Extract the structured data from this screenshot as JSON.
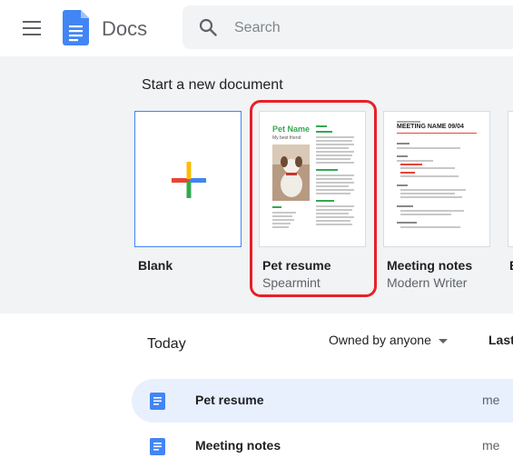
{
  "header": {
    "app_title": "Docs",
    "menu_icon": "hamburger-menu-icon",
    "logo_icon": "docs-logo-icon",
    "search": {
      "placeholder": "Search",
      "icon": "search-icon"
    }
  },
  "gallery": {
    "title": "Start a new document",
    "templates": [
      {
        "name": "Blank",
        "subtitle": ""
      },
      {
        "name": "Pet resume",
        "subtitle": "Spearmint",
        "preview": {
          "heading": "Pet Name",
          "subheading": "My best friend"
        }
      },
      {
        "name": "Meeting notes",
        "subtitle": "Modern Writer",
        "preview": {
          "heading": "MEETING NAME 09/04"
        }
      },
      {
        "name": "B",
        "subtitle": ""
      }
    ]
  },
  "documents": {
    "section_title": "Today",
    "owner_filter": "Owned by anyone",
    "sort_label": "Last",
    "rows": [
      {
        "name": "Pet resume",
        "owner": "me"
      },
      {
        "name": "Meeting notes",
        "owner": "me"
      }
    ]
  },
  "colors": {
    "google_blue": "#4285f4",
    "highlight_red": "#e8202a",
    "spearmint_green": "#34a853"
  }
}
